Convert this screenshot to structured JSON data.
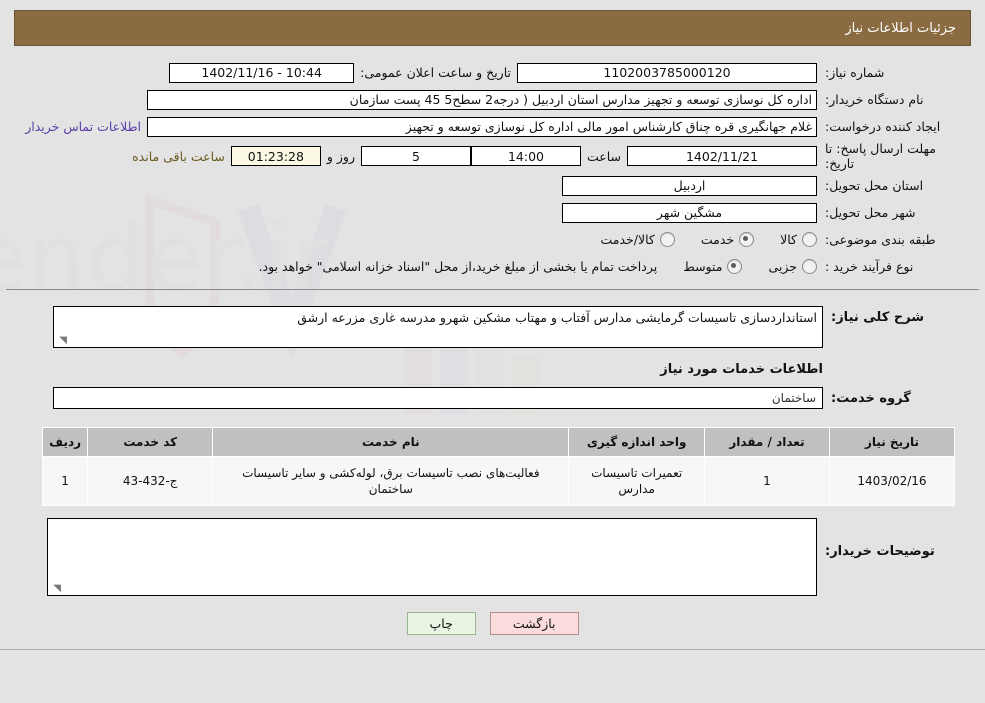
{
  "header": {
    "title": "جزئیات اطلاعات نیاز"
  },
  "form": {
    "need_no_label": "شماره نیاز:",
    "need_no_value": "1102003785000120",
    "announce_label": "تاریخ و ساعت اعلان عمومی:",
    "announce_value": "10:44 - 1402/11/16",
    "buyer_org_label": "نام دستگاه خریدار:",
    "buyer_org_value": "اداره کل نوسازی   توسعه و تجهیز مدارس استان اردبیل ( درجه2  سطح5  45 پست سازمان",
    "creator_label": "ایجاد کننده درخواست:",
    "creator_value": "غلام جهانگیری قره چناق کارشناس امور مالی اداره کل نوسازی   توسعه و تجهیز",
    "contact_link": "اطلاعات تماس خریدار",
    "deadline_label": "مهلت ارسال پاسخ: تا تاریخ:",
    "deadline_value": "1402/11/21",
    "hour_label": "ساعت",
    "hour_value": "14:00",
    "days_value": "5",
    "days_label": "روز و",
    "counter_value": "01:23:28",
    "remaining_label": "ساعت باقی مانده",
    "province_label": "استان محل تحویل:",
    "province_value": "اردبیل",
    "city_label": "شهر محل تحویل:",
    "city_value": "مشگین شهر",
    "category_label": "طبقه بندی موضوعی:",
    "category_options": [
      {
        "label": "کالا",
        "checked": false
      },
      {
        "label": "خدمت",
        "checked": true
      },
      {
        "label": "کالا/خدمت",
        "checked": false
      }
    ],
    "process_label": "نوع فرآیند خرید :",
    "process_options": [
      {
        "label": "جزیی",
        "checked": false
      },
      {
        "label": "متوسط",
        "checked": true
      }
    ],
    "payment_note": "پرداخت تمام یا بخشی از مبلغ خرید،از محل \"اسناد خزانه اسلامی\" خواهد بود."
  },
  "description": {
    "label": "شرح کلی نیاز:",
    "value": "استانداردسازی تاسیسات گرمایشی مدارس آفتاب و مهتاب مشکین شهرو مدرسه غاری مزرعه ارشق"
  },
  "services": {
    "section_title": "اطلاعات خدمات مورد نیاز",
    "group_label": "گروه خدمت:",
    "group_value": "ساختمان",
    "columns": [
      "ردیف",
      "کد خدمت",
      "نام خدمت",
      "واحد اندازه گیری",
      "تعداد / مقدار",
      "تاریخ نیاز"
    ],
    "rows": [
      {
        "radif": "1",
        "code": "ج-432-43",
        "name": "فعالیت‌های نصب تاسیسات برق، لوله‌کشی و سایر تاسیسات ساختمان",
        "unit": "تعمیرات تاسیسات مدارس",
        "qty": "1",
        "date": "1403/02/16"
      }
    ]
  },
  "buyer_notes": {
    "label": "توضیحات خریدار:",
    "value": ""
  },
  "footer": {
    "back_label": "بازگشت",
    "print_label": "چاپ"
  },
  "watermark": {
    "text": "AriaTender.ir"
  }
}
